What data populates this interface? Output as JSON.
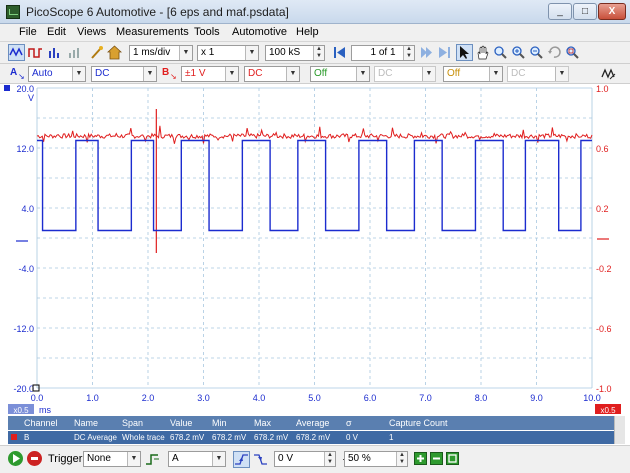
{
  "window": {
    "title": "PicoScope 6 Automotive - [6 eps and maf.psdata]",
    "minimize": "_",
    "maximize": "□",
    "close": "X"
  },
  "menu": {
    "items": [
      "File",
      "Edit",
      "Views",
      "Measurements",
      "Tools",
      "Automotive",
      "Help"
    ]
  },
  "toolbar": {
    "timebase": "1 ms/div",
    "multiplier": "x 1",
    "samples": "100 kS",
    "buffer": "1 of 1"
  },
  "channel_toolbar": {
    "a_letter": "A",
    "a_range": "Auto",
    "a_coupling": "DC",
    "b_letter": "B",
    "b_range": "±1 V",
    "b_coupling": "DC",
    "c_state": "Off",
    "c_coupling": "DC",
    "d_state": "Off",
    "d_coupling": "DC"
  },
  "colors": {
    "channel_a": "#1c2ccf",
    "channel_b": "#e01e1e",
    "grid": "#a8c8e0",
    "zoom_badge": "#7b8fd8",
    "table_header": "#5a7fb0",
    "table_row": "#3f6aa4"
  },
  "scope": {
    "a_unit": "V",
    "b_unit": "V",
    "a_ticks": [
      "20.0",
      "12.0",
      "4.0",
      "-4.0",
      "-12.0",
      "-20.0"
    ],
    "b_ticks": [
      "1.0",
      "0.6",
      "0.2",
      "-0.2",
      "-0.6",
      "-1.0"
    ],
    "x_ticks": [
      "0.0",
      "1.0",
      "2.0",
      "3.0",
      "4.0",
      "5.0",
      "6.0",
      "7.0",
      "8.0",
      "9.0",
      "10.0"
    ],
    "x_unit": "ms",
    "zoom_left": "x0.5",
    "zoom_right": "x0.5"
  },
  "measurements": {
    "headers": [
      "Channel",
      "Name",
      "Span",
      "Value",
      "Min",
      "Max",
      "Average",
      "σ",
      "Capture Count"
    ],
    "rows": [
      {
        "channel": "B",
        "name": "DC Average",
        "span": "Whole trace",
        "value": "678.2 mV",
        "min": "678.2 mV",
        "max": "678.2 mV",
        "average": "678.2 mV",
        "sigma": "0 V",
        "count": "1"
      }
    ]
  },
  "statusbar": {
    "trigger_label": "Trigger",
    "trigger_mode": "None",
    "trigger_source": "A",
    "trigger_level": "0 V",
    "pretrigger": "50 %"
  },
  "chart_data": {
    "type": "line",
    "x_unit": "ms",
    "xlim": [
      0,
      10
    ],
    "series": [
      {
        "name": "A",
        "y_unit": "V",
        "ylim": [
          -20,
          20
        ],
        "low": 1.0,
        "high": 13.0,
        "edges_ms": [
          0.0,
          0.1,
          0.7,
          1.1,
          1.7,
          2.1,
          2.6,
          3.1,
          3.7,
          4.2,
          4.7,
          5.2,
          5.8,
          6.3,
          6.8,
          7.3,
          7.9,
          8.4,
          8.8,
          9.4,
          9.8,
          10.0
        ]
      },
      {
        "name": "B",
        "y_unit": "V",
        "ylim": [
          -1,
          1
        ],
        "baseline": 0.68,
        "glitch_ms": 2.15,
        "glitch_min": -0.1,
        "glitch_max": 0.86
      }
    ]
  }
}
